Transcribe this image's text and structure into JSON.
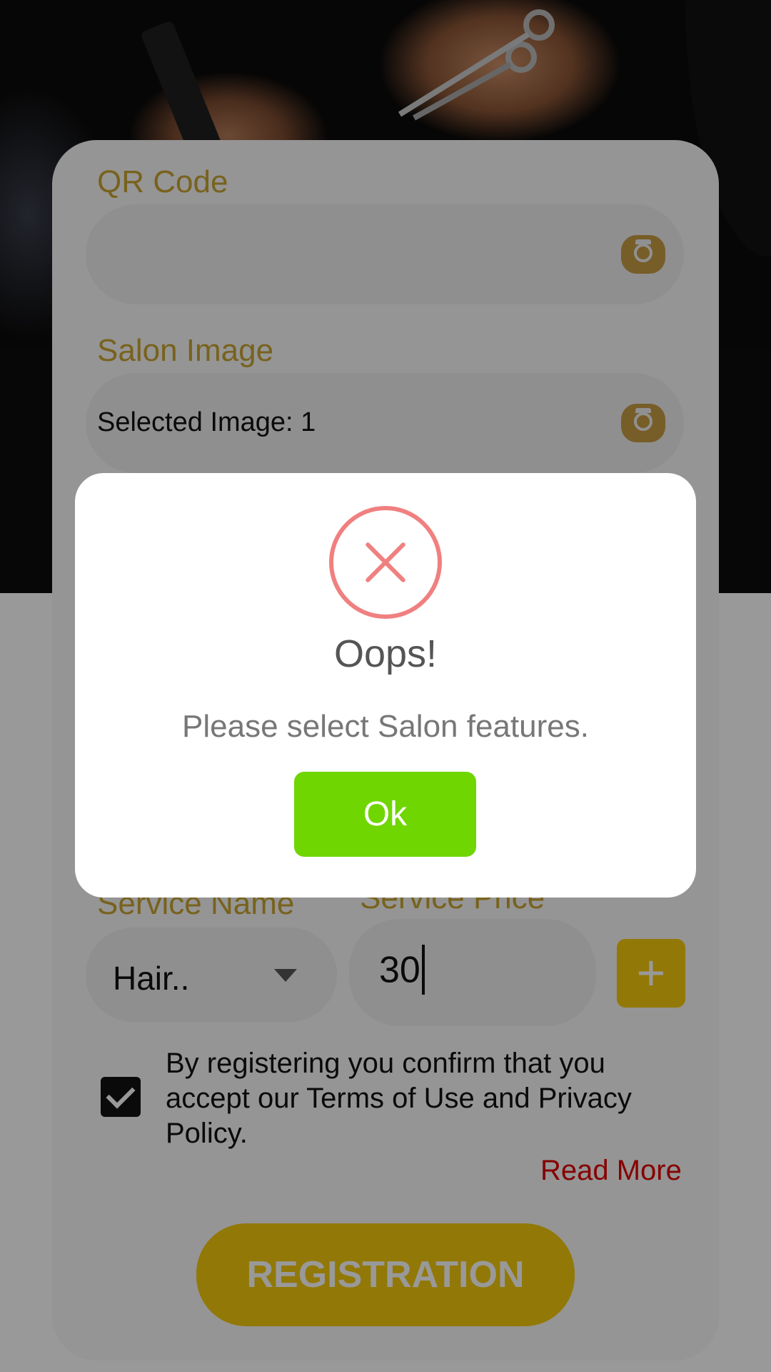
{
  "form": {
    "qr_label": "QR Code",
    "qr_value": "",
    "salon_image_label": "Salon Image",
    "salon_image_value": "Selected Image: 1",
    "service_name_label": "Service Name",
    "service_name_value": "Hair..",
    "service_price_label": "Service Price",
    "service_price_value": "30",
    "add_label": "+",
    "terms_text": "By registering you confirm that you accept our Terms of Use and Privacy Policy.",
    "terms_checked": true,
    "read_more": "Read More",
    "register_label": "REGISTRATION"
  },
  "dialog": {
    "title": "Oops!",
    "message": "Please select Salon features.",
    "ok_label": "Ok"
  },
  "colors": {
    "accent": "#f4c90c",
    "label": "#c8a431",
    "ok_button": "#6fd602",
    "error_icon": "#f08080",
    "read_more": "#e00000"
  },
  "icons": {
    "qr": "camera-icon",
    "salon_image": "camera-icon",
    "dialog": "error-x-icon",
    "dropdown": "caret-down-icon",
    "checkbox": "checkmark-icon"
  }
}
